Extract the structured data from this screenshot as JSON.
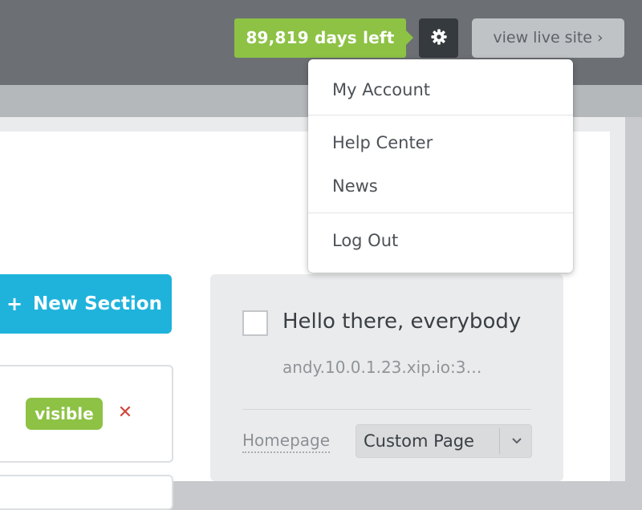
{
  "header": {
    "days_left_label": "89,819 days left",
    "view_live_site_label": "view live site ›",
    "settings_icon": "gear-icon"
  },
  "settings_menu": {
    "items": [
      {
        "label": "My Account"
      },
      {
        "label": "Help Center"
      },
      {
        "label": "News"
      },
      {
        "label": "Log Out"
      }
    ]
  },
  "sections": {
    "new_section_plus": "+",
    "new_section_label": "New Section",
    "row_status_badge": "visible",
    "row_remove_icon": "✕"
  },
  "page_panel": {
    "title": "Hello there, everybody",
    "url": "andy.10.0.1.23.xip.io:3…",
    "homepage_label": "Homepage",
    "page_type_selected": "Custom Page"
  },
  "colors": {
    "topbar": "#6c7074",
    "accent_green": "#8dc245",
    "accent_blue": "#1fb3dc",
    "gear_button": "#353a3e",
    "remove_red": "#d0463a"
  }
}
